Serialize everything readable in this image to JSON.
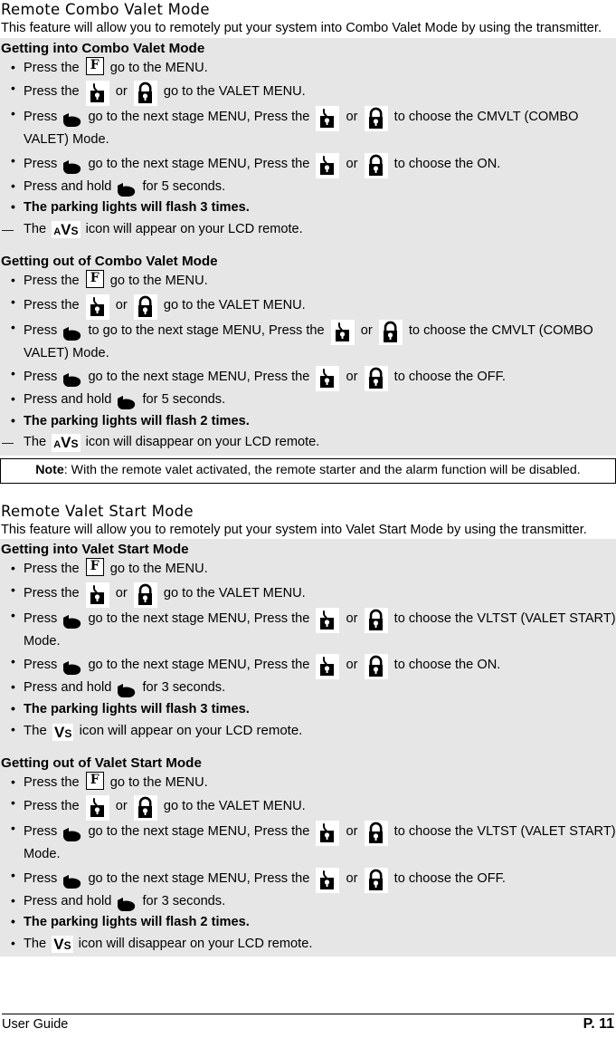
{
  "page": {
    "footer_left": "User Guide",
    "footer_right": "P. 11"
  },
  "icons": {
    "menu_button": "F",
    "lock": "lock-icon",
    "unlock": "unlock-icon",
    "hand": "hand-pointer-icon",
    "avs_a": "A",
    "avs_v": "V",
    "avs_s": "S",
    "vs_v": "V",
    "vs_s": "S"
  },
  "sections": [
    {
      "title": "Remote Combo Valet Mode",
      "intro": "This feature will allow you to remotely put your system into Combo Valet Mode by using the transmitter.",
      "blocks": [
        {
          "heading": "Getting into Combo Valet Mode",
          "steps": [
            {
              "pre": "Press the",
              "post": "go to the MENU."
            },
            {
              "pre": "Press the",
              "mid": "or",
              "post": "go to the VALET MENU."
            },
            {
              "pre": "Press",
              "mid": "go to the next stage MENU, Press the",
              "mid2": "or",
              "post": "to choose the CMVLT (COMBO VALET) Mode."
            },
            {
              "pre": "Press",
              "mid": "go to the next stage MENU, Press the",
              "mid2": "or",
              "post": "to choose the ON."
            },
            {
              "pre": "Press and hold",
              "post": "for 5 seconds."
            },
            {
              "text": "The parking lights will flash 3 times."
            },
            {
              "pre": "The",
              "post": "icon will appear on your LCD remote."
            }
          ]
        },
        {
          "heading": "Getting out of Combo Valet Mode",
          "steps": [
            {
              "pre": "Press the",
              "post": "go to the MENU."
            },
            {
              "pre": "Press the",
              "mid": "or",
              "post": "go to the VALET MENU."
            },
            {
              "pre": "Press",
              "mid": "to go to the next stage MENU, Press the",
              "mid2": "or",
              "post": "to choose the CMVLT (COMBO VALET) Mode."
            },
            {
              "pre": "Press",
              "mid": "go to the next stage MENU, Press the",
              "mid2": "or",
              "post": "to choose the OFF."
            },
            {
              "pre": "Press and hold",
              "post": "for 5 seconds."
            },
            {
              "text": "The parking lights will flash 2 times."
            },
            {
              "pre": "The",
              "post": "icon will disappear on your LCD remote."
            }
          ]
        }
      ],
      "note_label": "Note",
      "note_text": ": With the remote valet activated, the remote starter and the alarm function will be disabled."
    },
    {
      "title": "Remote Valet Start Mode",
      "intro": "This feature will allow you to remotely put your system into Valet Start Mode by using the transmitter.",
      "blocks": [
        {
          "heading": "Getting into Valet Start Mode",
          "steps": [
            {
              "pre": "Press the",
              "post": "go to the MENU."
            },
            {
              "pre": "Press the",
              "mid": "or",
              "post": "go to the VALET MENU."
            },
            {
              "pre": "Press",
              "mid": "go to the next stage MENU, Press the",
              "mid2": "or",
              "post": "to choose the VLTST (VALET START) Mode."
            },
            {
              "pre": "Press",
              "mid": "go to the next stage MENU, Press the",
              "mid2": "or",
              "post": "to choose the ON."
            },
            {
              "pre": "Press and hold",
              "post": "for 3 seconds."
            },
            {
              "text": "The parking lights will flash 3 times."
            },
            {
              "pre": "The",
              "post": "icon will appear on your LCD remote."
            }
          ]
        },
        {
          "heading": "Getting out of Valet Start Mode",
          "steps": [
            {
              "pre": "Press the",
              "post": "go to the MENU."
            },
            {
              "pre": "Press the",
              "mid": "or",
              "post": "go to the VALET MENU."
            },
            {
              "pre": "Press",
              "mid": "go to the next stage MENU, Press the",
              "mid2": "or",
              "post": "to choose the VLTST (VALET START) Mode."
            },
            {
              "pre": "Press",
              "mid": "go to the next stage MENU, Press  the",
              "mid2": "or",
              "post": "to choose the OFF."
            },
            {
              "pre": "Press and hold",
              "post": "for 3 seconds."
            },
            {
              "text": "The parking lights will flash 2 times."
            },
            {
              "pre": "The",
              "post": "icon will disappear on your LCD remote."
            }
          ]
        }
      ]
    }
  ]
}
